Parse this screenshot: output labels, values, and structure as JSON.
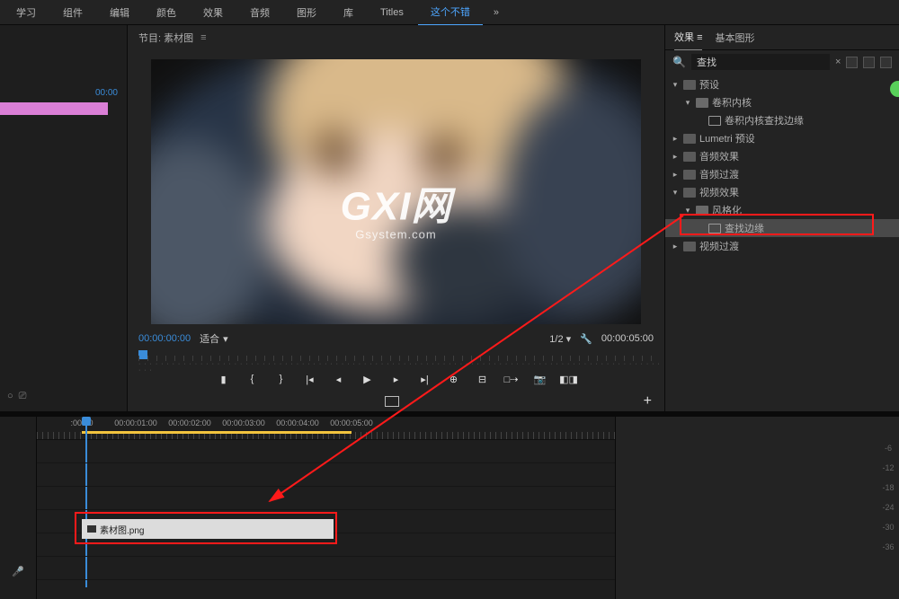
{
  "top_tabs": {
    "t0": "学习",
    "t1": "组件",
    "t2": "编辑",
    "t3": "颜色",
    "t4": "效果",
    "t5": "音频",
    "t6": "图形",
    "t7": "库",
    "t8": "Titles",
    "t9": "这个不错",
    "more": "»"
  },
  "left_panel": {
    "timecode": "00:00",
    "footer_a": "○",
    "footer_b": "⎚"
  },
  "program": {
    "header_label": "节目: 素材图",
    "menu_glyph": "≡",
    "watermark_big": "GXI网",
    "watermark_small": "Gsystem.com",
    "timecode_current": "00:00:00:00",
    "fit_label": "适合",
    "ratio_label": "1/2",
    "timecode_duration": "00:00:05:00"
  },
  "transport": {
    "mark_in": "▮",
    "brace_l": "{",
    "brace_r": "}",
    "prev": "|◂",
    "step_back": "◂",
    "play": "▶",
    "step_fwd": "▸",
    "next": "▸|",
    "insert": "⊕",
    "overwrite": "⊟",
    "export": "□⇢",
    "camera": "📷",
    "compare": "◧◨"
  },
  "monitor_footer": {
    "plus": "+"
  },
  "effects_panel": {
    "tab_effects": "效果",
    "tab_graphics": "基本图形",
    "search_value": "查找",
    "clear_glyph": "×",
    "tree": {
      "presets": "预设",
      "conv_kernel": "卷积内核",
      "conv_find_edges": "卷积内核查找边缘",
      "lumetri": "Lumetri 预设",
      "audio_fx": "音频效果",
      "audio_tr": "音频过渡",
      "video_fx": "视频效果",
      "stylize": "风格化",
      "find_edges": "查找边缘",
      "video_tr": "视频过渡"
    }
  },
  "timeline": {
    "ticks": {
      "t0": ":00:00",
      "t1": "00:00:01:00",
      "t2": "00:00:02:00",
      "t3": "00:00:03:00",
      "t4": "00:00:04:00",
      "t5": "00:00:05:00"
    },
    "clip_name": "素材图.png",
    "mic_glyph": "🎤",
    "scale": {
      "s0": "-6",
      "s1": "-12",
      "s2": "-18",
      "s3": "-24",
      "s4": "-30",
      "s5": "-36"
    }
  }
}
